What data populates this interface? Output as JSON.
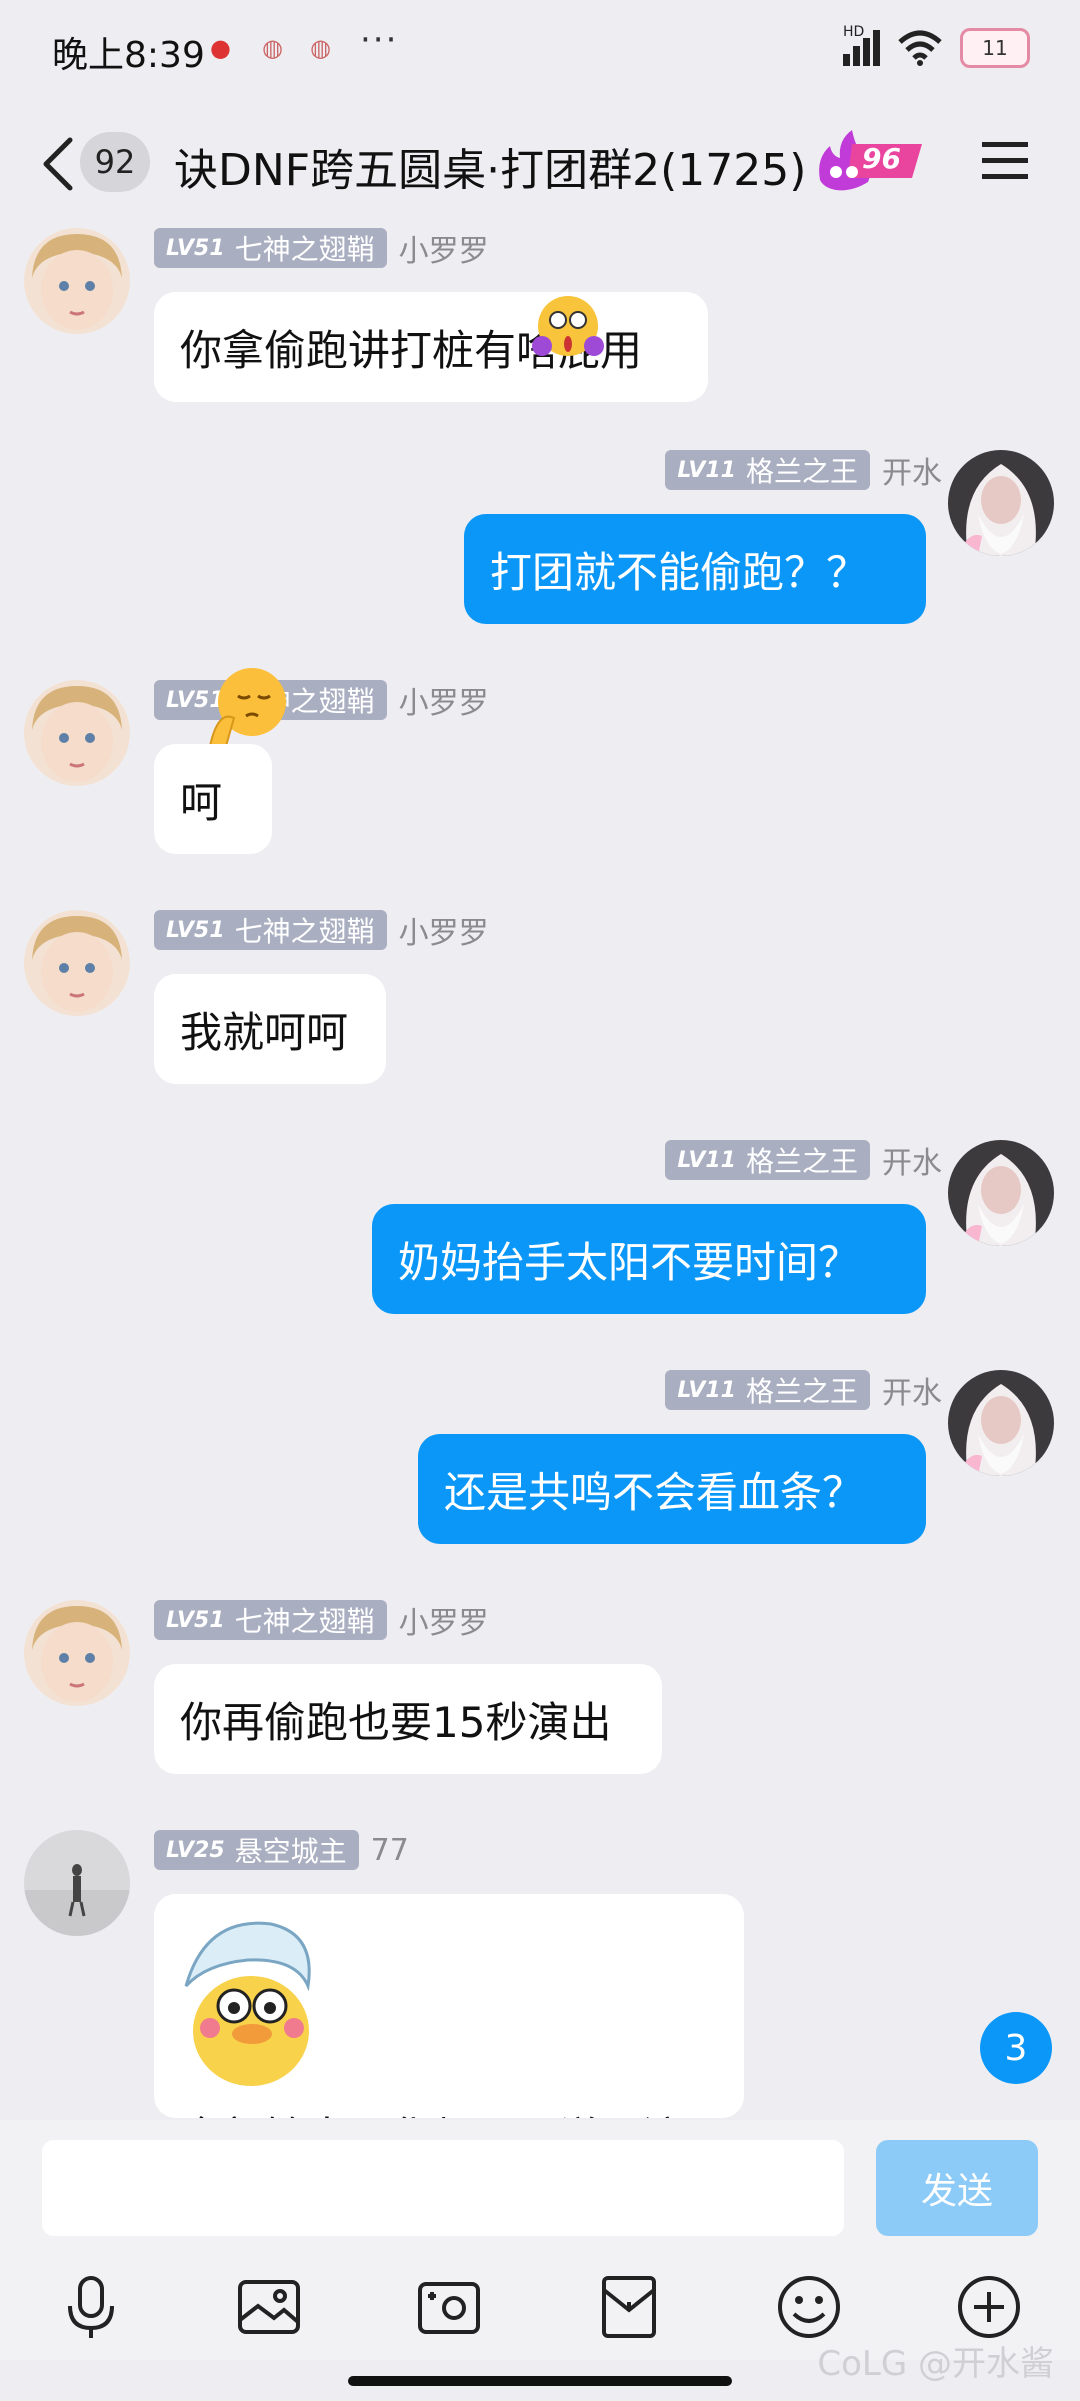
{
  "status_bar": {
    "time": "晚上8:39",
    "notification_icons": [
      "notification-icon",
      "notification-icon",
      "notification-icon"
    ],
    "more": "···",
    "network": "HD",
    "battery": "11"
  },
  "header": {
    "unread_count": "92",
    "title": "诀DNF跨五圆桌·打团群2(1725)",
    "group_level": "96"
  },
  "messages": [
    {
      "side": "in",
      "level": "LV51",
      "title": "七神之翅鞘",
      "nickname": "小罗罗",
      "text": "你拿偷跑讲打桩有啥屁用"
    },
    {
      "side": "out",
      "level": "LV11",
      "title": "格兰之王",
      "nickname": "开水",
      "text": "打团就不能偷跑？？"
    },
    {
      "side": "in",
      "level": "LV51",
      "title": "七神之翅鞘",
      "nickname": "小罗罗",
      "text": "呵"
    },
    {
      "side": "in",
      "level": "LV51",
      "title": "七神之翅鞘",
      "nickname": "小罗罗",
      "text": "我就呵呵"
    },
    {
      "side": "out",
      "level": "LV11",
      "title": "格兰之王",
      "nickname": "开水",
      "text": "奶妈抬手太阳不要时间？"
    },
    {
      "side": "out",
      "level": "LV11",
      "title": "格兰之王",
      "nickname": "开水",
      "text": "还是共鸣不会看血条？"
    },
    {
      "side": "in",
      "level": "LV51",
      "title": "七神之翅鞘",
      "nickname": "小罗罗",
      "text": "你再偷跑也要15秒演出"
    },
    {
      "side": "in",
      "level": "LV25",
      "title": "悬空城主",
      "nickname": "77",
      "text": "全部输出阳化都可以说理流"
    }
  ],
  "new_messages_count": "3",
  "composer": {
    "placeholder": "",
    "send_label": "发送"
  },
  "toolbar": [
    "microphone-icon",
    "image-icon",
    "camera-icon",
    "red-packet-icon",
    "emoji-icon",
    "plus-icon"
  ],
  "watermark": "CoLG @开水酱",
  "colors": {
    "accent": "#0b97f7",
    "background": "#eeeef2",
    "level_badge": "#a9aec0"
  }
}
